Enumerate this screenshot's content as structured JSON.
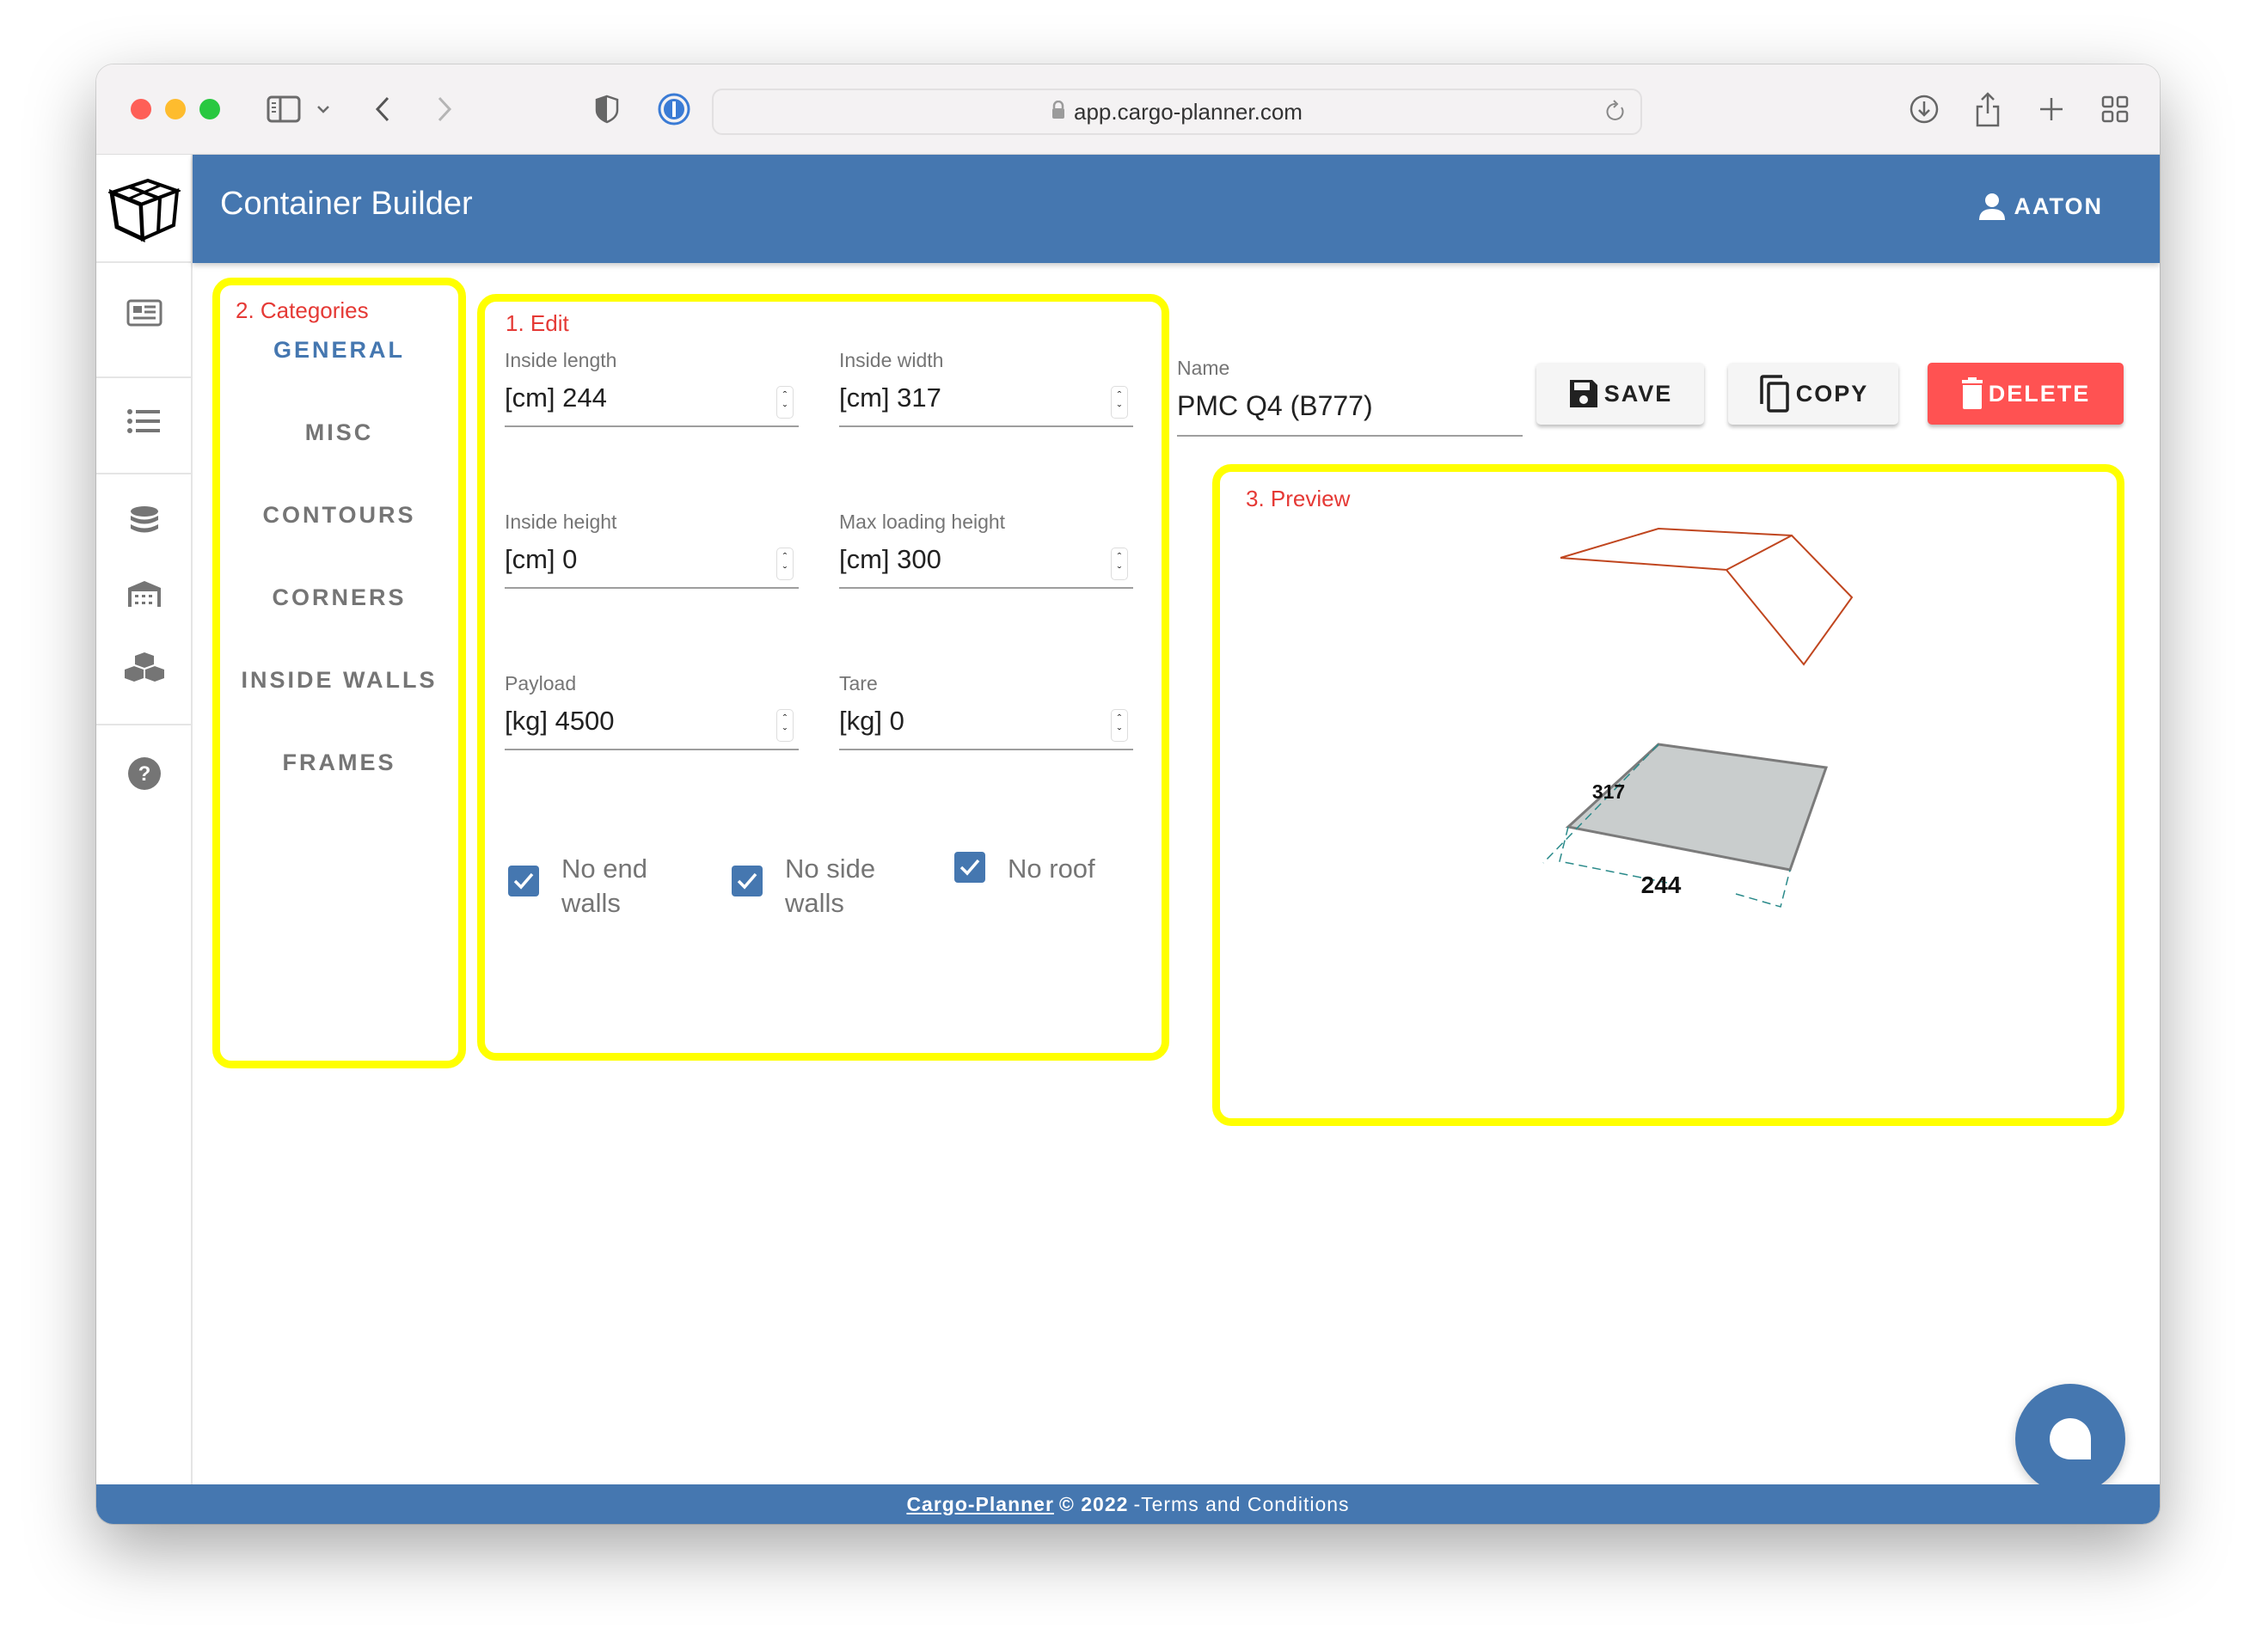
{
  "browser": {
    "url": "app.cargo-planner.com",
    "icons": [
      "sidebar-toggle-icon",
      "chevron-down-icon",
      "back-icon",
      "forward-icon",
      "shield-icon",
      "password-manager-icon",
      "lock-icon",
      "reload-icon",
      "download-icon",
      "share-icon",
      "new-tab-icon",
      "tab-overview-icon"
    ]
  },
  "app": {
    "title": "Container Builder",
    "user": "AATON",
    "rail_items": [
      {
        "icon": "article-icon",
        "label": "Loadplans"
      },
      {
        "icon": "list-icon",
        "label": "Lists"
      },
      {
        "icon": "database-icon",
        "label": "Cargo library"
      },
      {
        "icon": "warehouse-icon",
        "label": "Equipment"
      },
      {
        "icon": "boxes-icon",
        "label": "Cargo"
      },
      {
        "icon": "help-icon",
        "label": "Help"
      }
    ]
  },
  "annotations": {
    "categories": "2. Categories",
    "edit": "1. Edit",
    "preview": "3. Preview"
  },
  "categories": {
    "active": "GENERAL",
    "items": [
      "GENERAL",
      "MISC",
      "CONTOURS",
      "CORNERS",
      "INSIDE WALLS",
      "FRAMES"
    ]
  },
  "edit": {
    "fields": [
      {
        "label": "Inside length",
        "unit": "[cm]",
        "value": "244",
        "display": "[cm] 244"
      },
      {
        "label": "Inside width",
        "unit": "[cm]",
        "value": "317",
        "display": "[cm] 317"
      },
      {
        "label": "Inside height",
        "unit": "[cm]",
        "value": "0",
        "display": "[cm] 0"
      },
      {
        "label": "Max loading height",
        "unit": "[cm]",
        "value": "300",
        "display": "[cm] 300"
      },
      {
        "label": "Payload",
        "unit": "[kg]",
        "value": "4500",
        "display": "[kg] 4500"
      },
      {
        "label": "Tare",
        "unit": "[kg]",
        "value": "0",
        "display": "[kg] 0"
      }
    ],
    "checkboxes": [
      {
        "label": "No end walls",
        "checked": true
      },
      {
        "label": "No side walls",
        "checked": true
      },
      {
        "label": "No roof",
        "checked": true
      }
    ]
  },
  "name_field": {
    "label": "Name",
    "value": "PMC Q4 (B777)"
  },
  "actions": {
    "save": "SAVE",
    "copy": "COPY",
    "delete": "DELETE"
  },
  "preview": {
    "length_label": "244",
    "width_label": "317"
  },
  "footer": {
    "brand": "Cargo-Planner",
    "copyright": "© 2022",
    "terms": "-Terms and Conditions"
  },
  "colors": {
    "primary": "#4577b0",
    "danger": "#ff5252",
    "annotation": "#e53935",
    "highlight": "#ffff00"
  }
}
